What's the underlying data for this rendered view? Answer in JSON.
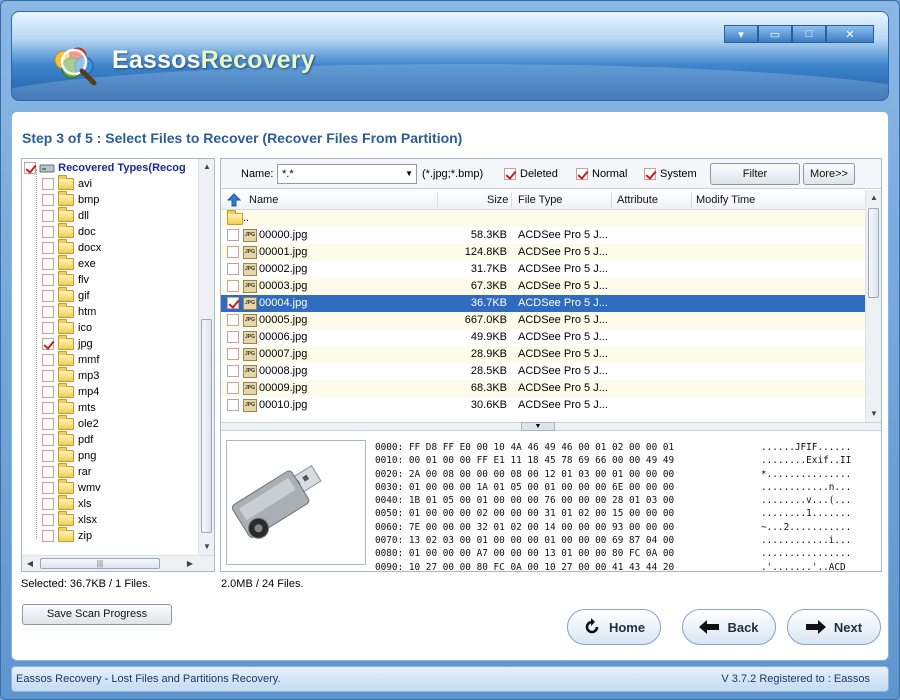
{
  "app": {
    "name_part1": "Eassos",
    "name_part2": "Recovery"
  },
  "window_controls": [
    "▾",
    "▭",
    "□",
    "✕"
  ],
  "step_title": "Step 3 of 5 : Select Files to Recover (Recover Files From Partition)",
  "tree": {
    "root_label": "Recovered Types(Recog",
    "items": [
      {
        "label": "avi",
        "checked": false
      },
      {
        "label": "bmp",
        "checked": false
      },
      {
        "label": "dll",
        "checked": false
      },
      {
        "label": "doc",
        "checked": false
      },
      {
        "label": "docx",
        "checked": false
      },
      {
        "label": "exe",
        "checked": false
      },
      {
        "label": "flv",
        "checked": false
      },
      {
        "label": "gif",
        "checked": false
      },
      {
        "label": "htm",
        "checked": false
      },
      {
        "label": "ico",
        "checked": false
      },
      {
        "label": "jpg",
        "checked": true
      },
      {
        "label": "mmf",
        "checked": false
      },
      {
        "label": "mp3",
        "checked": false
      },
      {
        "label": "mp4",
        "checked": false
      },
      {
        "label": "mts",
        "checked": false
      },
      {
        "label": "ole2",
        "checked": false
      },
      {
        "label": "pdf",
        "checked": false
      },
      {
        "label": "png",
        "checked": false
      },
      {
        "label": "rar",
        "checked": false
      },
      {
        "label": "wmv",
        "checked": false
      },
      {
        "label": "xls",
        "checked": false
      },
      {
        "label": "xlsx",
        "checked": false
      },
      {
        "label": "zip",
        "checked": false
      }
    ],
    "hscroll_grip": "|||"
  },
  "filter": {
    "name_label": "Name:",
    "name_value": "*.*",
    "name_hint": "(*.jpg;*.bmp)",
    "deleted_label": "Deleted",
    "normal_label": "Normal",
    "system_label": "System",
    "filter_button": "Filter",
    "more_button": "More>>"
  },
  "columns": {
    "name": "Name",
    "size": "Size",
    "type": "File Type",
    "attribute": "Attribute",
    "modify": "Modify Time"
  },
  "parent_dir": "..",
  "files": [
    {
      "name": "00000.jpg",
      "size": "58.3KB",
      "type": "ACDSee Pro 5 J...",
      "checked": false,
      "selected": false
    },
    {
      "name": "00001.jpg",
      "size": "124.8KB",
      "type": "ACDSee Pro 5 J...",
      "checked": false,
      "selected": false
    },
    {
      "name": "00002.jpg",
      "size": "31.7KB",
      "type": "ACDSee Pro 5 J...",
      "checked": false,
      "selected": false
    },
    {
      "name": "00003.jpg",
      "size": "67.3KB",
      "type": "ACDSee Pro 5 J...",
      "checked": false,
      "selected": false
    },
    {
      "name": "00004.jpg",
      "size": "36.7KB",
      "type": "ACDSee Pro 5 J...",
      "checked": true,
      "selected": true
    },
    {
      "name": "00005.jpg",
      "size": "667.0KB",
      "type": "ACDSee Pro 5 J...",
      "checked": false,
      "selected": false
    },
    {
      "name": "00006.jpg",
      "size": "49.9KB",
      "type": "ACDSee Pro 5 J...",
      "checked": false,
      "selected": false
    },
    {
      "name": "00007.jpg",
      "size": "28.9KB",
      "type": "ACDSee Pro 5 J...",
      "checked": false,
      "selected": false
    },
    {
      "name": "00008.jpg",
      "size": "28.5KB",
      "type": "ACDSee Pro 5 J...",
      "checked": false,
      "selected": false
    },
    {
      "name": "00009.jpg",
      "size": "68.3KB",
      "type": "ACDSee Pro 5 J...",
      "checked": false,
      "selected": false
    },
    {
      "name": "00010.jpg",
      "size": "30.6KB",
      "type": "ACDSee Pro 5 J...",
      "checked": false,
      "selected": false
    }
  ],
  "jpg_icon_text": "JPG",
  "hex_lines": [
    "0000: FF D8 FF E0 00 10 4A 46 49 46 00 01 02 00 00 01",
    "0010: 00 01 00 00 FF E1 11 18 45 78 69 66 00 00 49 49",
    "0020: 2A 00 08 00 00 00 08 00 12 01 03 00 01 00 00 00",
    "0030: 01 00 00 00 1A 01 05 00 01 00 00 00 6E 00 00 00",
    "0040: 1B 01 05 00 01 00 00 00 76 00 00 00 28 01 03 00",
    "0050: 01 00 00 00 02 00 00 00 31 01 02 00 15 00 00 00",
    "0060: 7E 00 00 00 32 01 02 00 14 00 00 00 93 00 00 00",
    "0070: 13 02 03 00 01 00 00 00 01 00 00 00 69 87 04 00",
    "0080: 01 00 00 00 A7 00 00 00 13 01 00 00 80 FC 0A 00",
    "0090: 10 27 00 00 80 FC 0A 00 10 27 00 00 41 43 44 20"
  ],
  "ascii_lines": [
    "......JFIF......",
    "........Exif..II",
    "*...............",
    "............n...",
    "........v...(...",
    "........1.......",
    "~...2...........",
    "............i...",
    "................",
    ".'.......'..ACD"
  ],
  "status": {
    "selected": "Selected: 36.7KB / 1 Files.",
    "total": "2.0MB / 24 Files."
  },
  "buttons": {
    "save_scan": "Save Scan Progress",
    "home": "Home",
    "back": "Back",
    "next": "Next"
  },
  "footer": {
    "left": "Eassos Recovery - Lost Files and Partitions Recovery.",
    "right": "V 3.7.2  Registered to : Eassos"
  }
}
